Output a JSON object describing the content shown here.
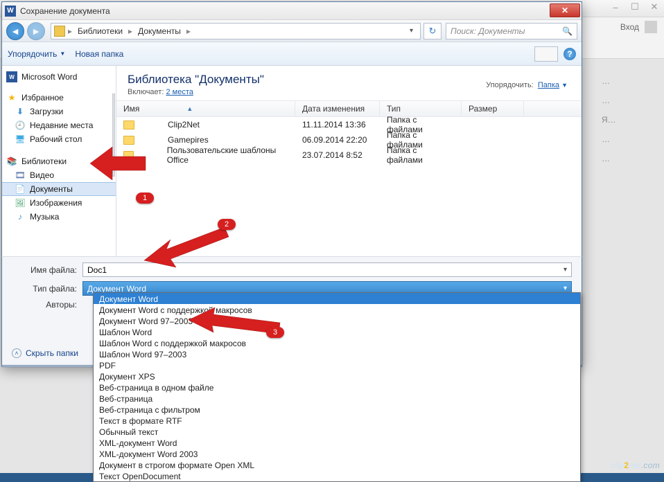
{
  "word_app": {
    "login_label": "Вход",
    "right_hints": [
      "…",
      "…",
      "Я…",
      "…",
      "…"
    ]
  },
  "dialog": {
    "title": "Сохранение документа",
    "breadcrumb": {
      "seg1": "Библиотеки",
      "seg2": "Документы"
    },
    "search_placeholder": "Поиск: Документы",
    "toolbar": {
      "organize": "Упорядочить",
      "newfolder": "Новая папка"
    },
    "sidebar": {
      "top": "Microsoft Word",
      "fav_header": "Избранное",
      "fav_items": [
        "Загрузки",
        "Недавние места",
        "Рабочий стол"
      ],
      "lib_header": "Библиотеки",
      "lib_items": [
        "Видео",
        "Документы",
        "Изображения",
        "Музыка"
      ],
      "selected_index": 1
    },
    "main": {
      "lib_title": "Библиотека \"Документы\"",
      "lib_sub_prefix": "Включает:",
      "lib_sub_link": "2 места",
      "sort_prefix": "Упорядочить:",
      "sort_link": "Папка",
      "columns": {
        "name": "Имя",
        "date": "Дата изменения",
        "type": "Тип",
        "size": "Размер"
      },
      "rows": [
        {
          "name": "Clip2Net",
          "date": "11.11.2014 13:36",
          "type": "Папка с файлами"
        },
        {
          "name": "Gamepires",
          "date": "06.09.2014 22:20",
          "type": "Папка с файлами"
        },
        {
          "name": "Пользовательские шаблоны Office",
          "date": "23.07.2014 8:52",
          "type": "Папка с файлами"
        }
      ]
    },
    "fields": {
      "filename_label": "Имя файла:",
      "filename_value": "Doc1",
      "filetype_label": "Тип файла:",
      "filetype_value": "Документ Word",
      "authors_label": "Авторы:"
    },
    "hide_folders": "Скрыть папки"
  },
  "dropdown": {
    "items": [
      "Документ Word",
      "Документ Word с поддержкой макросов",
      "Документ Word 97–2003",
      "Шаблон Word",
      "Шаблон Word с поддержкой макросов",
      "Шаблон Word 97–2003",
      "PDF",
      "Документ XPS",
      "Веб-страница в одном файле",
      "Веб-страница",
      "Веб-страница с фильтром",
      "Текст в формате RTF",
      "Обычный текст",
      "XML-документ Word",
      "XML-документ Word 2003",
      "Документ в строгом формате Open XML",
      "Текст OpenDocument"
    ],
    "selected_index": 0
  },
  "annotations": {
    "b1": "1",
    "b2": "2",
    "b3": "3"
  },
  "watermark": {
    "a": "clip",
    "b": "2",
    "c": "net",
    "d": ".com"
  }
}
